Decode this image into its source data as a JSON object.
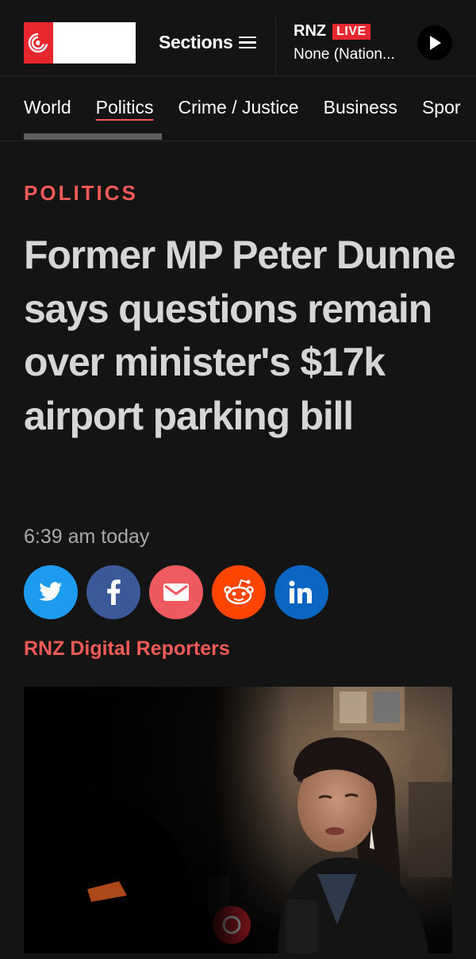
{
  "header": {
    "sections_label": "Sections",
    "live_brand": "RNZ",
    "live_badge": "LIVE",
    "station": "None (Nation..."
  },
  "nav": {
    "items": [
      "World",
      "Politics",
      "Crime / Justice",
      "Business",
      "Spor"
    ],
    "active": "Politics"
  },
  "article": {
    "kicker": "POLITICS",
    "headline": "Former MP Peter Dunne says questions remain over minister's $17k airport parking bill",
    "timestamp": "6:39 am today",
    "byline": "RNZ Digital Reporters"
  },
  "share": {
    "icons": [
      "twitter-icon",
      "facebook-icon",
      "email-icon",
      "reddit-icon",
      "linkedin-icon"
    ]
  },
  "colors": {
    "background": "#141414",
    "accent": "#f15a57",
    "brand_red": "#e8262d",
    "headline": "#d5d7d6"
  }
}
